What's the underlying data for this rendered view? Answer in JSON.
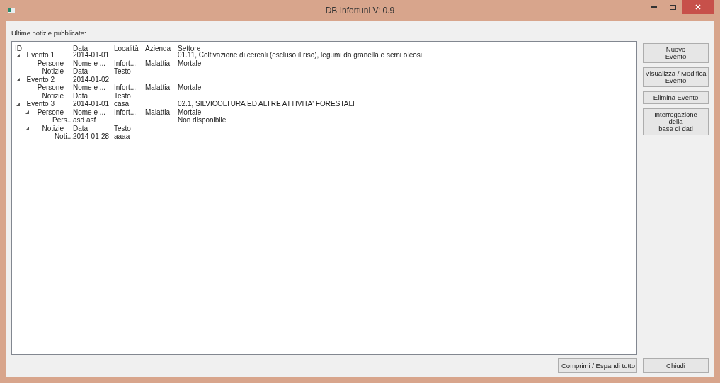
{
  "window": {
    "title": "DB Infortuni V: 0.9"
  },
  "list_label": "Ultime notizie pubblicate:",
  "tree": {
    "columns": [
      "ID",
      "Data",
      "Località",
      "Azienda",
      "Settore"
    ],
    "rows": [
      {
        "id": "Evento 1",
        "data": "2014-01-01",
        "settore": "01.11, Coltivazione di cereali (escluso il riso), legumi da granella e semi oleosi",
        "expanded": true,
        "children": [
          {
            "id": "Persone",
            "data": "Nome e ...",
            "localita": "Infort...",
            "azienda": "Malattia",
            "settore": "Mortale"
          },
          {
            "id": "Notizie",
            "data": "Data",
            "localita": "Testo"
          }
        ]
      },
      {
        "id": "Evento 2",
        "data": "2014-01-02",
        "expanded": true,
        "children": [
          {
            "id": "Persone",
            "data": "Nome e ...",
            "localita": "Infort...",
            "azienda": "Malattia",
            "settore": "Mortale"
          },
          {
            "id": "Notizie",
            "data": "Data",
            "localita": "Testo"
          }
        ]
      },
      {
        "id": "Evento 3",
        "data": "2014-01-01",
        "localita": "casa",
        "settore": "02.1, SILVICOLTURA ED ALTRE ATTIVITA' FORESTALI",
        "expanded": true,
        "children": [
          {
            "id": "Persone",
            "data": "Nome e ...",
            "localita": "Infort...",
            "azienda": "Malattia",
            "settore": "Mortale",
            "expanded": true,
            "children": [
              {
                "id": "Pers...",
                "data": "asd asf",
                "settore": "Non disponibile"
              }
            ]
          },
          {
            "id": "Notizie",
            "data": "Data",
            "localita": "Testo",
            "expanded": true,
            "children": [
              {
                "id": "Noti...",
                "data": "2014-01-28",
                "localita": "aaaa"
              }
            ]
          }
        ]
      }
    ]
  },
  "side_buttons": [
    [
      "Nuovo",
      "Evento"
    ],
    [
      "Visualizza / Modifica",
      "Evento"
    ],
    [
      "Elimina Evento"
    ],
    [
      "Interrogazione",
      "della",
      "base di dati"
    ]
  ],
  "bottom_buttons": {
    "toggle": "Comprimi / Espandi tutto",
    "close": "Chiudi"
  }
}
